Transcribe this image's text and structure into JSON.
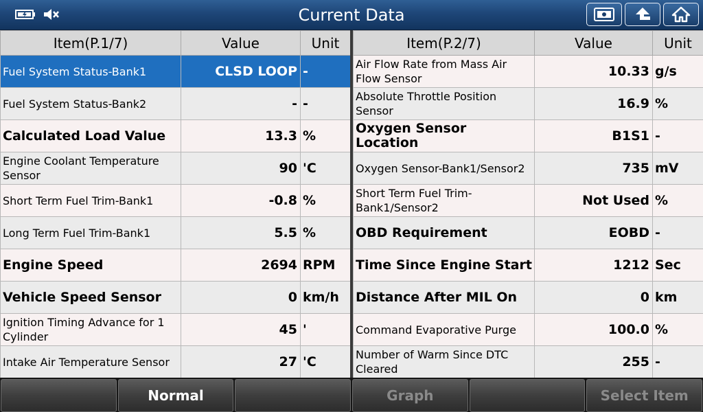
{
  "header": {
    "title": "Current Data"
  },
  "left_table": {
    "columns": [
      "Item(P.1/7)",
      "Value",
      "Unit"
    ],
    "rows": [
      {
        "item": "Fuel System Status-Bank1",
        "value": "CLSD LOOP",
        "unit": "-",
        "selected": true
      },
      {
        "item": "Fuel System Status-Bank2",
        "value": "-",
        "unit": "-"
      },
      {
        "item": "Calculated Load Value",
        "value": "13.3",
        "unit": "%",
        "big": true
      },
      {
        "item": "Engine Coolant Temperature Sensor",
        "value": "90",
        "unit": "'C"
      },
      {
        "item": "Short Term Fuel Trim-Bank1",
        "value": "-0.8",
        "unit": "%"
      },
      {
        "item": "Long Term Fuel Trim-Bank1",
        "value": "5.5",
        "unit": "%"
      },
      {
        "item": "Engine Speed",
        "value": "2694",
        "unit": "RPM",
        "big": true
      },
      {
        "item": "Vehicle Speed Sensor",
        "value": "0",
        "unit": "km/h",
        "big": true
      },
      {
        "item": "Ignition Timing Advance for 1 Cylinder",
        "value": "45",
        "unit": "'"
      },
      {
        "item": "Intake Air Temperature Sensor",
        "value": "27",
        "unit": "'C"
      }
    ]
  },
  "right_table": {
    "columns": [
      "Item(P.2/7)",
      "Value",
      "Unit"
    ],
    "rows": [
      {
        "item": "Air Flow Rate from Mass Air Flow Sensor",
        "value": "10.33",
        "unit": "g/s"
      },
      {
        "item": "Absolute Throttle Position Sensor",
        "value": "16.9",
        "unit": "%"
      },
      {
        "item": "Oxygen Sensor Location",
        "value": "B1S1",
        "unit": "-",
        "big": true
      },
      {
        "item": "Oxygen Sensor-Bank1/Sensor2",
        "value": "735",
        "unit": "mV"
      },
      {
        "item": "Short Term Fuel Trim-Bank1/Sensor2",
        "value": "Not Used",
        "unit": "%"
      },
      {
        "item": "OBD Requirement",
        "value": "EOBD",
        "unit": "-",
        "big": true
      },
      {
        "item": "Time Since Engine Start",
        "value": "1212",
        "unit": "Sec",
        "big": true
      },
      {
        "item": "Distance After MIL On",
        "value": "0",
        "unit": "km",
        "big": true
      },
      {
        "item": "Command Evaporative Purge",
        "value": "100.0",
        "unit": "%"
      },
      {
        "item": "Number of Warm Since DTC Cleared",
        "value": "255",
        "unit": "-"
      }
    ]
  },
  "bottom_bar": {
    "buttons": [
      {
        "label": "",
        "disabled": false
      },
      {
        "label": "Normal",
        "disabled": false
      },
      {
        "label": "",
        "disabled": false
      },
      {
        "label": "Graph",
        "disabled": true
      },
      {
        "label": "",
        "disabled": false
      },
      {
        "label": "Select Item",
        "disabled": true
      }
    ]
  },
  "colors": {
    "title_bar": "#1e4678",
    "selected_row": "#1f6fbf",
    "row_odd": "#f8f1f1",
    "row_even": "#ebebeb"
  },
  "icons": {
    "status": [
      "battery-icon",
      "speaker-muted-icon"
    ],
    "nav": [
      "screenshot-icon",
      "back-icon",
      "home-icon"
    ]
  }
}
